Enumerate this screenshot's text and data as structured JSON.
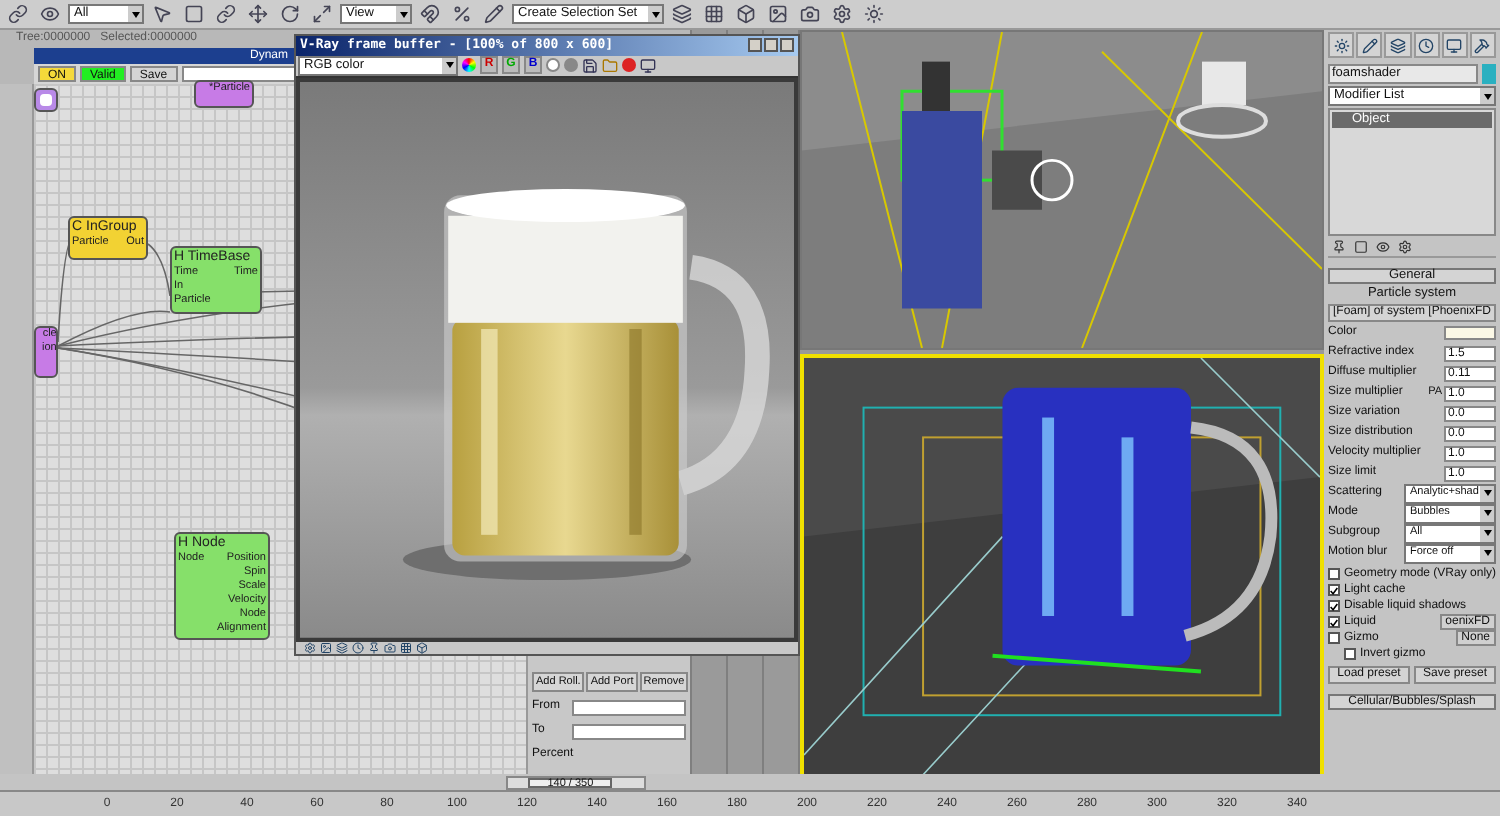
{
  "toolbar": {
    "selection_filter": "All",
    "coordinate_system": "View",
    "named_selection": "Create Selection Set"
  },
  "particle_view": {
    "status": "Tree:0000000   Selected:0000000",
    "title": "Dynam",
    "buttons": [
      {
        "label": "ON",
        "kind": "on"
      },
      {
        "label": "Valid",
        "kind": "valid"
      },
      {
        "label": "Save",
        "kind": "plain"
      }
    ],
    "nodes": [
      {
        "kind": "port",
        "color": "#b98ae8"
      },
      {
        "kind": "node",
        "color": "#c77be6",
        "outputs": [
          "*Particle"
        ]
      },
      {
        "kind": "node",
        "color": "#f2d233",
        "title": "C InGroup",
        "inputs": [
          "Particle"
        ],
        "outputs": [
          "Out"
        ]
      },
      {
        "kind": "node",
        "color": "#86e06a",
        "title": "H TimeBase",
        "inputs": [
          "Time",
          "In",
          "Particle"
        ],
        "outputs": [
          "Time"
        ]
      },
      {
        "kind": "node",
        "color": "#c77be6",
        "outputs": [
          "cle",
          "ion"
        ]
      },
      {
        "kind": "node",
        "color": "#86e06a",
        "title": "H Node",
        "inputs": [
          "Node"
        ],
        "outputs": [
          "Position",
          "Spin",
          "Scale",
          "Velocity",
          "Node",
          "Alignment"
        ]
      }
    ],
    "side_buttons": [
      "Add Roll.",
      "Add Port",
      "Remove"
    ],
    "fields": [
      {
        "label": "From"
      },
      {
        "label": "To"
      }
    ],
    "percent": "Percent"
  },
  "frame_buffer": {
    "title": "V-Ray frame buffer - [100% of 800 x 600]",
    "channel": "RGB color",
    "channel_buttons": [
      "R",
      "G",
      "B"
    ]
  },
  "command_panel": {
    "object_name": "foamshader",
    "modifier_list": "Modifier List",
    "stack": [
      {
        "label": "Object",
        "selected": true
      }
    ],
    "rollout": "General",
    "section": "Particle system",
    "system_button": "[Foam] of system [PhoenixFD",
    "params": [
      {
        "kind": "color",
        "label": "Color"
      },
      {
        "kind": "spinner",
        "label": "Refractive index",
        "value": "1.5"
      },
      {
        "kind": "spinner",
        "label": "Diffuse multiplier",
        "value": "0.11"
      },
      {
        "kind": "spinner",
        "label": "Size multiplier",
        "tag": "PA",
        "value": "1.0"
      },
      {
        "kind": "spinner",
        "label": "Size variation",
        "value": "0.0"
      },
      {
        "kind": "spinner",
        "label": "Size distribution",
        "value": "0.0"
      },
      {
        "kind": "spinner",
        "label": "Velocity multiplier",
        "value": "1.0"
      },
      {
        "kind": "spinner",
        "label": "Size limit",
        "value": "1.0"
      },
      {
        "kind": "dropdown",
        "label": "Scattering",
        "value": "Analytic+shad"
      },
      {
        "kind": "dropdown",
        "label": "Mode",
        "value": "Bubbles"
      },
      {
        "kind": "dropdown",
        "label": "Subgroup",
        "value": "All"
      },
      {
        "kind": "dropdown",
        "label": "Motion blur",
        "value": "Force off"
      }
    ],
    "options": [
      {
        "label": "Geometry mode (VRay only)",
        "checked": false
      },
      {
        "label": "Light cache",
        "checked": true
      },
      {
        "label": "Disable liquid shadows",
        "checked": true
      },
      {
        "label": "Liquid",
        "checked": true,
        "button": "oenixFD"
      },
      {
        "label": "Gizmo",
        "checked": false,
        "button": "None",
        "children": [
          {
            "label": "Invert gizmo",
            "checked": false
          }
        ]
      }
    ],
    "presets": [
      "Load preset",
      "Save preset"
    ],
    "collapsed_rollout": "Cellular/Bubbles/Splash"
  },
  "time_slider": {
    "label": "140 / 350",
    "level": 0.4
  },
  "timeline": {
    "ticks": [
      "0",
      "20",
      "40",
      "60",
      "80",
      "100",
      "120",
      "140",
      "160",
      "180",
      "200",
      "220",
      "240",
      "260",
      "280",
      "300",
      "320",
      "340"
    ]
  }
}
